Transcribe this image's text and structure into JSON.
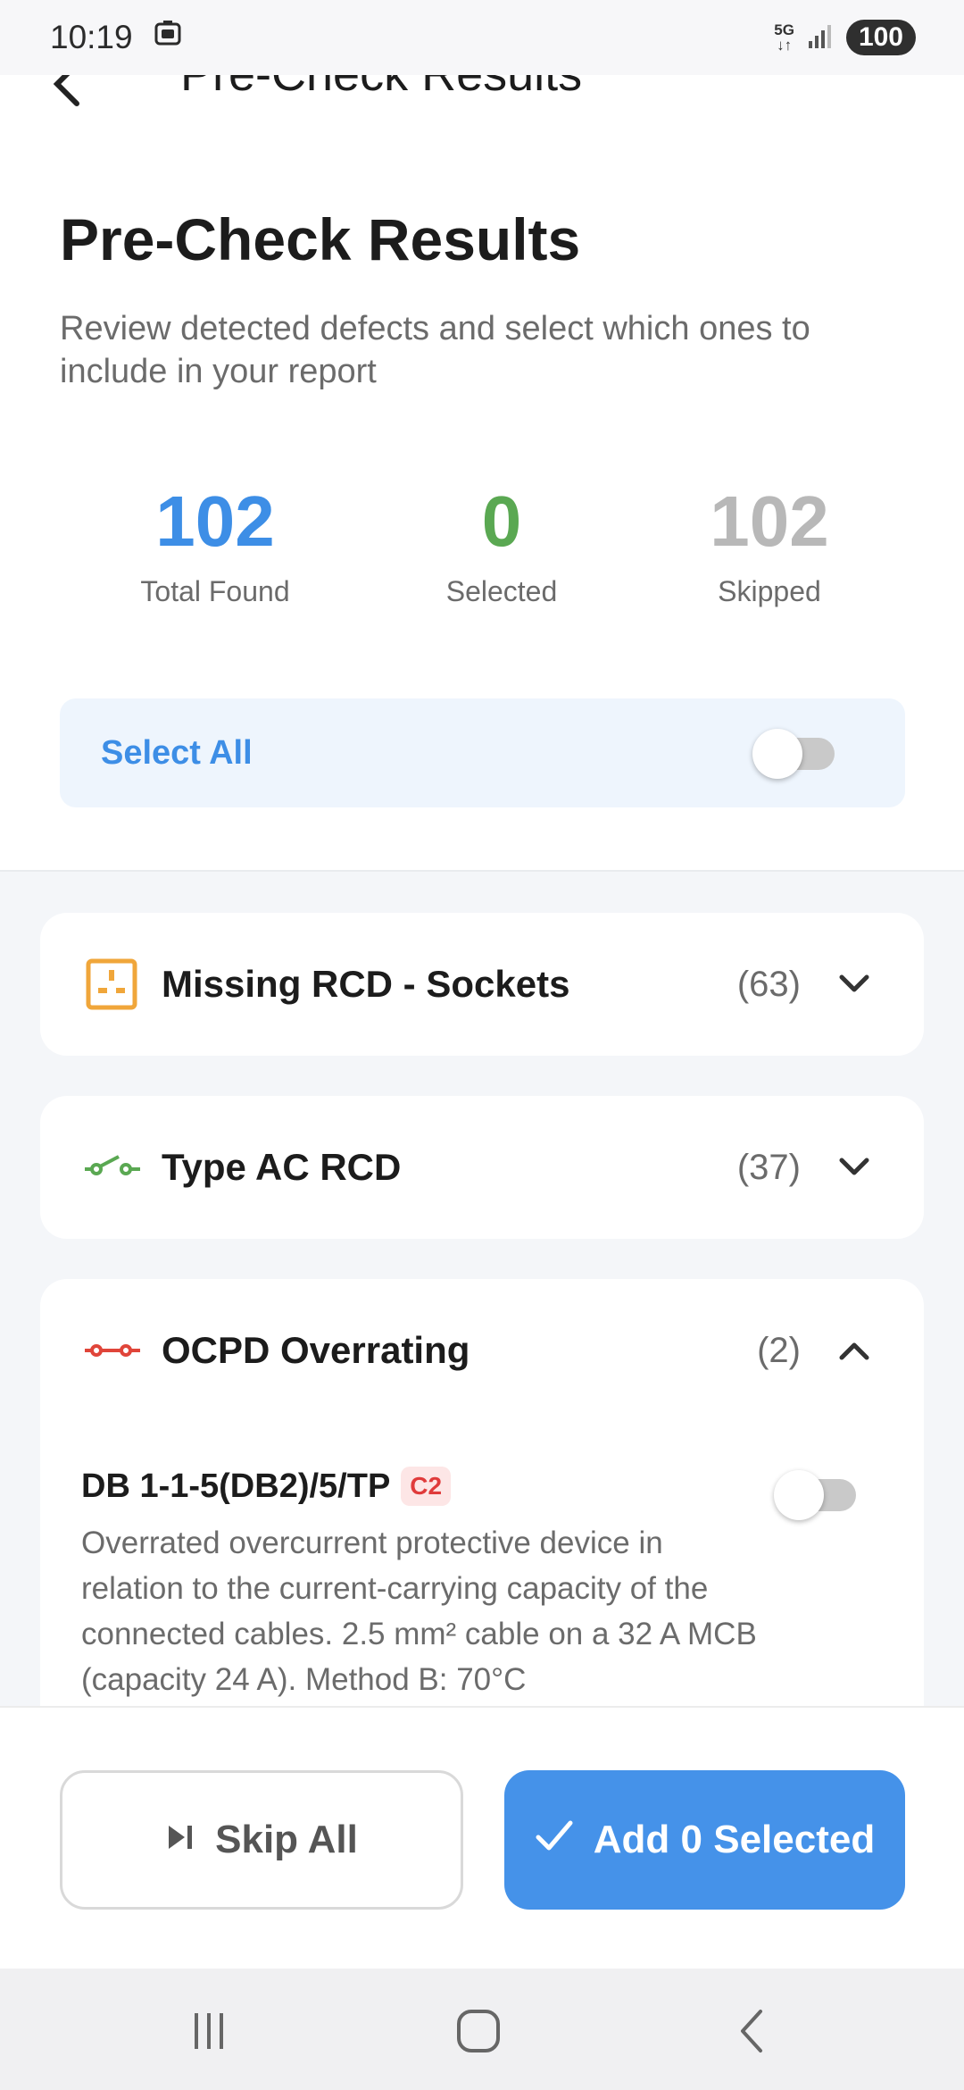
{
  "status_bar": {
    "time": "10:19",
    "network_top": "5G",
    "network_bottom": "↓↑",
    "battery": "100"
  },
  "header": {
    "title": "Pre-Check Results"
  },
  "intro": {
    "title": "Pre-Check Results",
    "subtitle": "Review detected defects and select which ones to include in your report"
  },
  "stats": {
    "total": {
      "value": "102",
      "label": "Total Found",
      "color": "#3d8ee6"
    },
    "selected": {
      "value": "0",
      "label": "Selected",
      "color": "#5aa852"
    },
    "skipped": {
      "value": "102",
      "label": "Skipped",
      "color": "#b8b8b8"
    }
  },
  "select_all": {
    "label": "Select All",
    "on": false
  },
  "groups": [
    {
      "title": "Missing RCD - Sockets",
      "count": "(63)",
      "icon": "socket-icon",
      "color": "#f0a63a",
      "expanded": false
    },
    {
      "title": "Type AC RCD",
      "count": "(37)",
      "icon": "switch-icon",
      "color": "#5aa852",
      "expanded": false
    },
    {
      "title": "OCPD Overrating",
      "count": "(2)",
      "icon": "breaker-icon",
      "color": "#e0453a",
      "expanded": true,
      "items": [
        {
          "circuit": "DB 1-1-5(DB2)/5/TP",
          "code": "C2",
          "description": "Overrated overcurrent protective device in relation to the current-carrying capacity of the connected cables. 2.5 mm² cable on a 32 A MCB (capacity 24 A). Method B: 70°C",
          "selected": false
        }
      ]
    }
  ],
  "actions": {
    "skip_label": "Skip All",
    "add_label": "Add 0 Selected"
  }
}
